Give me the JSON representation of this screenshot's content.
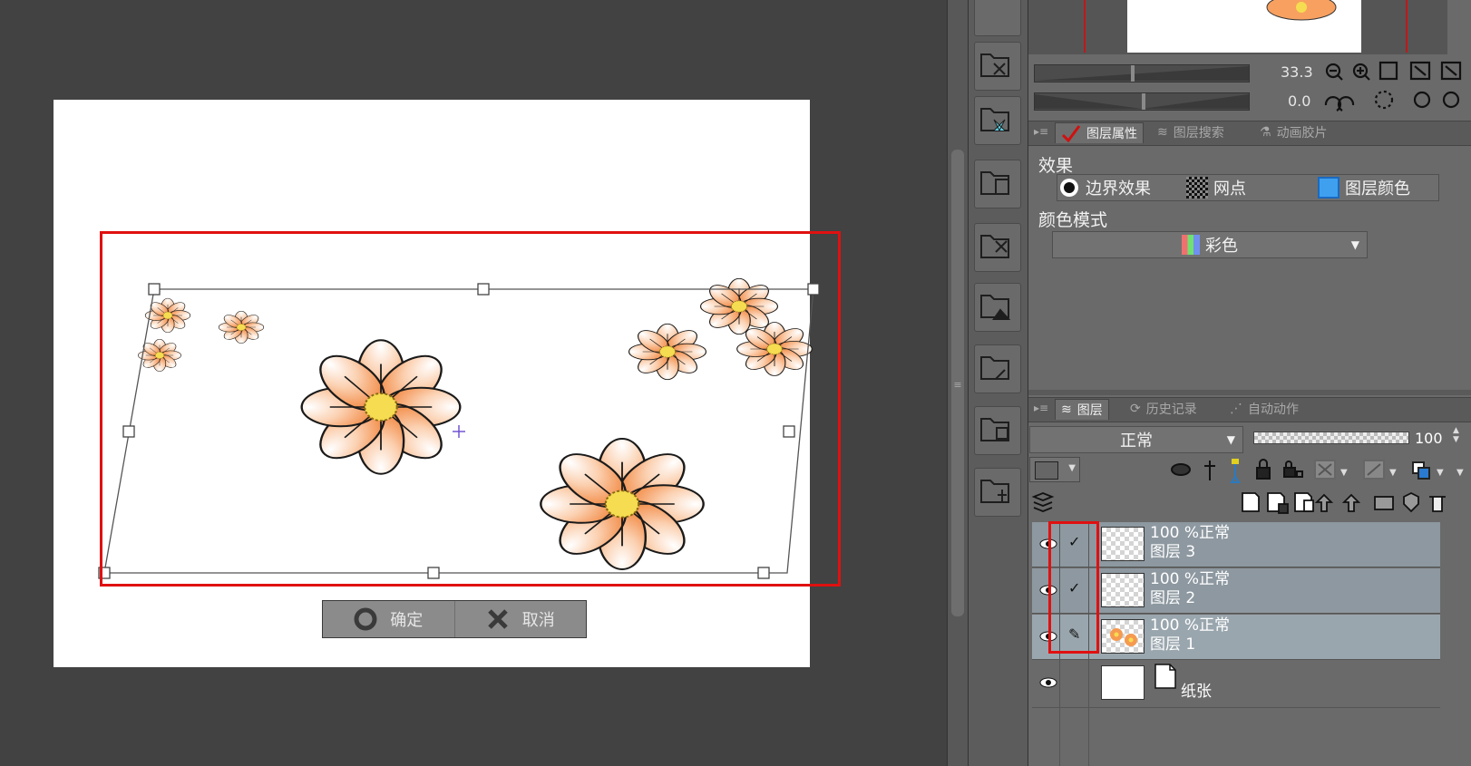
{
  "canvas": {
    "confirm_label": "确定",
    "cancel_label": "取消"
  },
  "navigator": {
    "zoom": "33.3",
    "rotation": "0.0"
  },
  "properties_panel": {
    "tabs": [
      "图层属性",
      "图层搜索",
      "动画胶片"
    ],
    "effect_title": "效果",
    "effects": [
      "边界效果",
      "网点",
      "图层颜色"
    ],
    "color_mode_title": "颜色模式",
    "color_mode_value": "彩色"
  },
  "layer_panel": {
    "tabs": [
      "图层",
      "历史记录",
      "自动动作"
    ],
    "blend_mode": "正常",
    "opacity": "100",
    "layers": [
      {
        "opacity_mode": "100 %正常",
        "name": "图层 3"
      },
      {
        "opacity_mode": "100 %正常",
        "name": "图层 2"
      },
      {
        "opacity_mode": "100 %正常",
        "name": "图层 1"
      },
      {
        "opacity_mode": "",
        "name": "纸张"
      }
    ]
  },
  "colors": {
    "highlight_red": "#e01010",
    "petal_orange": "#f58a3a",
    "flower_center": "#f5dc50",
    "selected_layer": "#8d98a0"
  }
}
